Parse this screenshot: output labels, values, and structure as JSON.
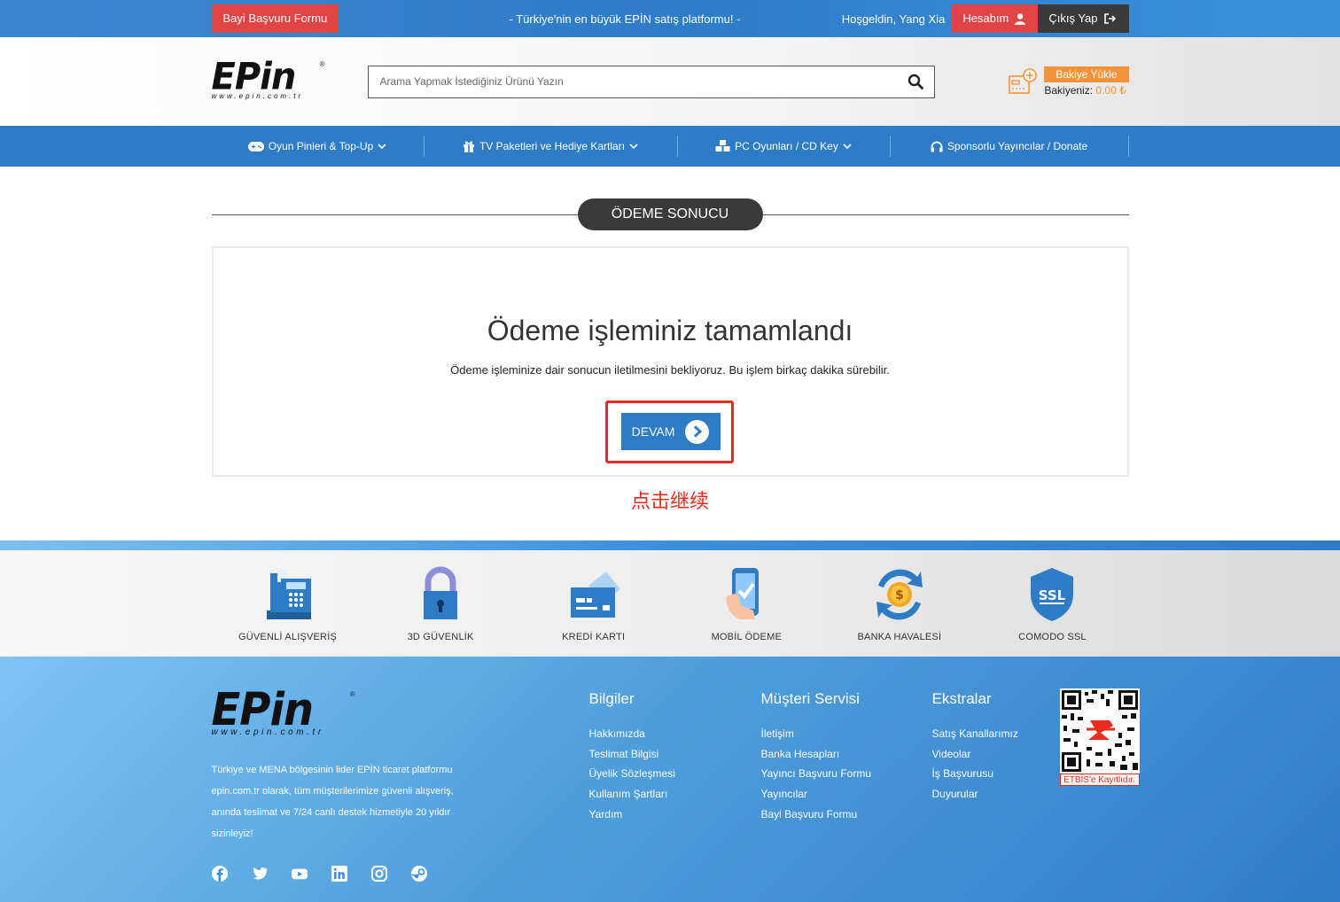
{
  "topbar": {
    "dealer_form": "Bayi Başvuru Formu",
    "slogan": "- Türkiye'nin en büyük EPİN satış platformu! -",
    "welcome": "Hoşgeldin, Yang Xia",
    "account": "Hesabım",
    "logout": "Çıkış Yap"
  },
  "header": {
    "logo_text": "EPin",
    "logo_sub": "www.epin.com.tr",
    "search_placeholder": "Arama Yapmak İstediğiniz Ürünü Yazın",
    "load_balance": "Bakiye Yükle",
    "balance_label": "Bakiyeniz:",
    "balance_value": "0.00 ₺"
  },
  "nav": {
    "items": [
      {
        "label": "Oyun Pinleri & Top-Up",
        "icon": "gamepad-icon"
      },
      {
        "label": "TV Paketleri ve Hediye Kartları",
        "icon": "gift-icon"
      },
      {
        "label": "PC Oyunları / CD Key",
        "icon": "cubes-icon"
      },
      {
        "label": "Sponsorlu Yayıncılar / Donate",
        "icon": "headphones-icon"
      }
    ]
  },
  "main": {
    "section_title": "ÖDEME SONUCU",
    "result_title": "Ödeme işleminiz tamamlandı",
    "result_desc": "Ödeme işleminize dair sonucun iletilmesini bekliyoruz. Bu işlem birkaç dakika sürebilir.",
    "continue_button": "DEVAM",
    "annotation": "点击继续",
    "annotation_color": "#e82b1f"
  },
  "features": [
    {
      "label": "GÜVENLİ ALIŞVERİŞ",
      "icon": "pos-terminal-icon"
    },
    {
      "label": "3D GÜVENLİK",
      "icon": "padlock-icon"
    },
    {
      "label": "KREDİ KARTI",
      "icon": "credit-card-icon"
    },
    {
      "label": "MOBİL ÖDEME",
      "icon": "mobile-payment-icon"
    },
    {
      "label": "BANKA HAVALESİ",
      "icon": "bank-transfer-icon"
    },
    {
      "label": "COMODO SSL",
      "icon": "ssl-shield-icon"
    }
  ],
  "footer": {
    "description": "Türkiye ve MENA bölgesinin lider EPİN ticaret platformu epin.com.tr olarak, tüm müşterilerimize güvenli alışveriş, anında teslimat ve 7/24 canlı destek hizmetiyle 20 yıldır sizinleyiz!",
    "columns": [
      {
        "title": "Bilgiler",
        "links": [
          "Hakkımızda",
          "Teslimat Bilgisi",
          "Üyelik Sözleşmesi",
          "Kullanım Şartları",
          "Yardım"
        ]
      },
      {
        "title": "Müşteri Servisi",
        "links": [
          "İletişim",
          "Banka Hesapları",
          "Yayıncı Başvuru Formu",
          "Yayıncılar",
          "Bayi Başvuru Formu"
        ]
      },
      {
        "title": "Ekstralar",
        "links": [
          "Satış Kanallarımız",
          "Videolar",
          "İş Başvurusu",
          "Duyurular"
        ]
      }
    ],
    "etbis_label": "ETBİS'e Kayıtlıdır.",
    "social": [
      "facebook-icon",
      "twitter-icon",
      "youtube-icon",
      "linkedin-icon",
      "instagram-icon",
      "steam-icon"
    ]
  },
  "colors": {
    "brand_blue": "#2f7cc6",
    "red": "#e04444",
    "orange": "#f5923a",
    "dark": "#3a3a3a"
  }
}
